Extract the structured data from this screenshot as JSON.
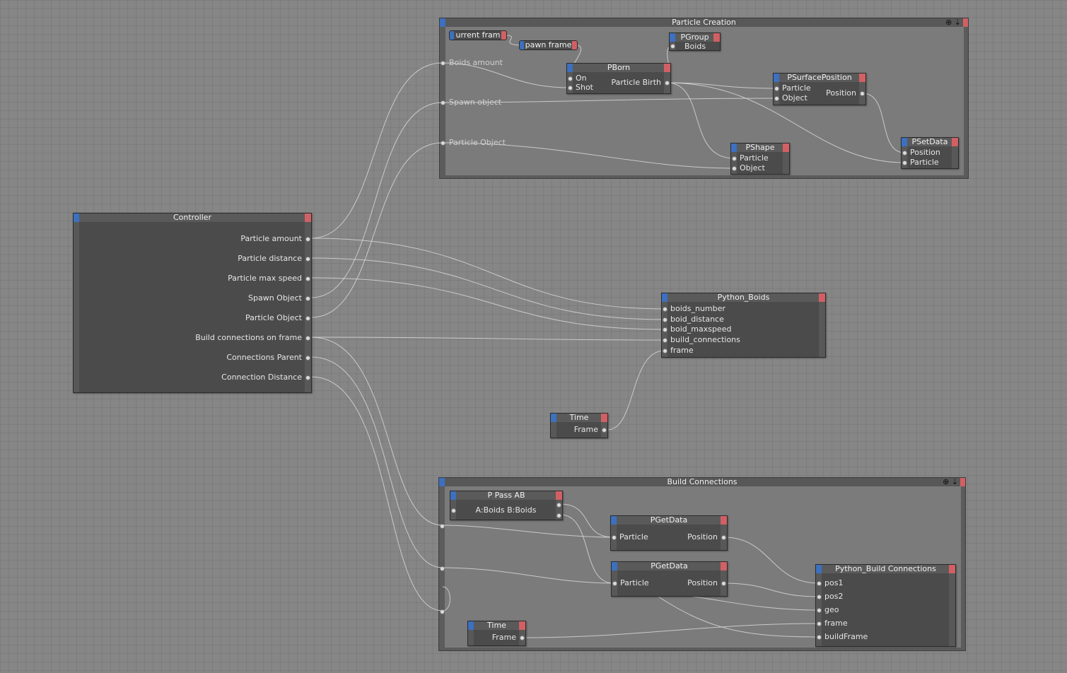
{
  "groups": {
    "particle_creation": {
      "title": "Particle Creation",
      "tools": "⊕ ⇣",
      "inputs": [
        "Boids amount",
        "Spawn object",
        "Particle Object"
      ]
    },
    "build_connections": {
      "title": "Build Connections",
      "tools": "⊕ ⇣"
    }
  },
  "nodes": {
    "current_frame": {
      "label": "urrent fram"
    },
    "spawn_frame": {
      "label": "pawn frame"
    },
    "pgroup": {
      "title": "PGroup",
      "out": "Boids"
    },
    "pborn": {
      "title": "PBorn",
      "in": [
        "On",
        "Shot"
      ],
      "out": "Particle Birth"
    },
    "psurfaceposition": {
      "title": "PSurfacePosition",
      "in": [
        "Particle",
        "Object"
      ],
      "out": "Position"
    },
    "pshape": {
      "title": "PShape",
      "in": [
        "Particle",
        "Object"
      ]
    },
    "psetdata": {
      "title": "PSetData",
      "in": [
        "Position",
        "Particle"
      ]
    },
    "controller": {
      "title": "Controller",
      "outs": [
        "Particle amount",
        "Particle distance",
        "Particle max speed",
        "Spawn Object",
        "Particle Object",
        "Build connections on frame",
        "Connections Parent",
        "Connection Distance"
      ]
    },
    "python_boids": {
      "title": "Python_Boids",
      "ins": [
        "boids_number",
        "boid_distance",
        "boid_maxspeed",
        "build_connections",
        "frame"
      ]
    },
    "time1": {
      "title": "Time",
      "out": "Frame"
    },
    "ppassab": {
      "title": "P Pass AB",
      "label": "A:Boids B:Boids"
    },
    "pgetdata1": {
      "title": "PGetData",
      "in": "Particle",
      "out": "Position"
    },
    "pgetdata2": {
      "title": "PGetData",
      "in": "Particle",
      "out": "Position"
    },
    "python_build": {
      "title": "Python_Build Connections",
      "ins": [
        "pos1",
        "pos2",
        "geo",
        "frame",
        "buildFrame"
      ]
    },
    "time2": {
      "title": "Time",
      "out": "Frame"
    }
  }
}
